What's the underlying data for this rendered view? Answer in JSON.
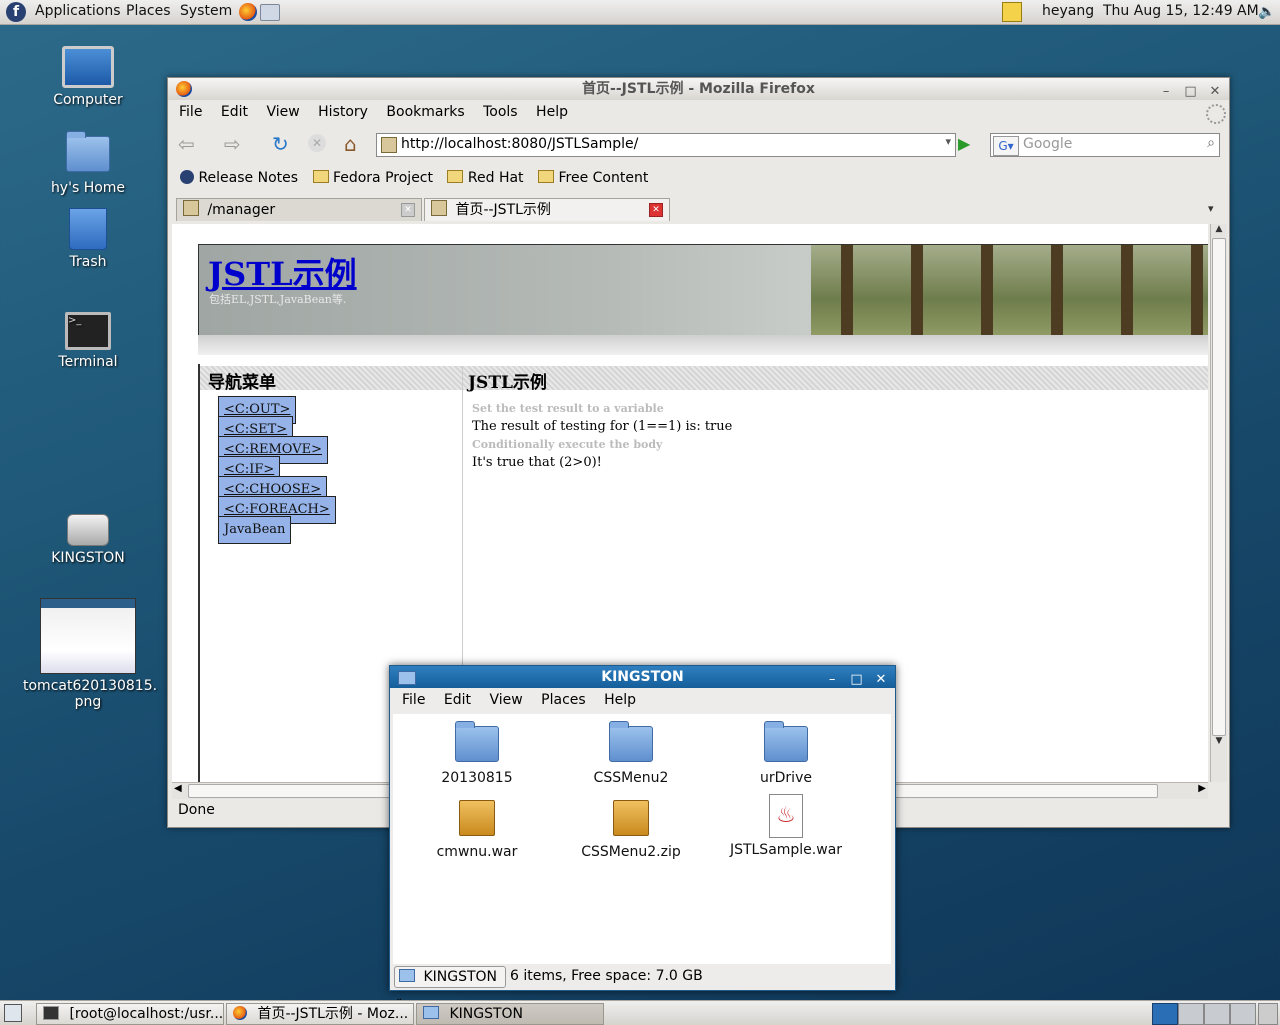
{
  "top_panel": {
    "menus": [
      "Applications",
      "Places",
      "System"
    ],
    "user": "heyang",
    "clock": "Thu Aug 15, 12:49 AM"
  },
  "desktop": {
    "icons": [
      "Computer",
      "hy's Home",
      "Trash",
      "Terminal",
      "KINGSTON",
      "tomcat620130815.\npng"
    ]
  },
  "firefox": {
    "title": "首页--JSTL示例  - Mozilla Firefox",
    "menus": [
      "File",
      "Edit",
      "View",
      "History",
      "Bookmarks",
      "Tools",
      "Help"
    ],
    "url": "http://localhost:8080/JSTLSample/",
    "search_placeholder": "Google",
    "bookmarks": [
      "Release Notes",
      "Fedora Project",
      "Red Hat",
      "Free Content"
    ],
    "tabs": [
      "/manager",
      "首页--JSTL示例"
    ],
    "status": "Done",
    "page": {
      "site_title": "JSTL示例",
      "subtitle": "包括EL,JSTL,JavaBean等.",
      "nav_heading": "导航菜单",
      "main_heading": "JSTL示例",
      "nav_links": [
        "<C:OUT>",
        "<C:SET>",
        "<C:REMOVE>",
        "<C:IF>",
        "<C:CHOOSE>",
        "<C:FOREACH>",
        "JavaBean"
      ],
      "lines": [
        "Set the test result to a variable",
        "The result of testing for (1==1) is: true",
        "Conditionally execute the body",
        "It's true that (2>0)!"
      ]
    }
  },
  "nautilus": {
    "title": "KINGSTON",
    "menus": [
      "File",
      "Edit",
      "View",
      "Places",
      "Help"
    ],
    "files": [
      "20130815",
      "CSSMenu2",
      "urDrive",
      "cmwnu.war",
      "CSSMenu2.zip",
      "JSTLSample.war"
    ],
    "location": "KINGSTON",
    "status": "6 items, Free space: 7.0 GB"
  },
  "taskbar": {
    "items": [
      "[root@localhost:/usr...",
      "首页--JSTL示例  - Moz...",
      "KINGSTON"
    ]
  },
  "colors": {
    "nav_link_bg": "#95b3e8",
    "title_link": "#0000cc",
    "active_title": "#155e9a"
  }
}
